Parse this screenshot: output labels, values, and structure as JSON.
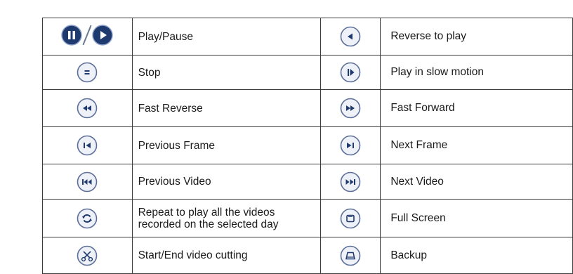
{
  "rows": [
    {
      "left_icon": "play-pause-icon",
      "left_label": "Play/Pause",
      "right_icon": "reverse-play-icon",
      "right_label": "Reverse to play"
    },
    {
      "left_icon": "stop-icon",
      "left_label": "Stop",
      "right_icon": "slow-motion-icon",
      "right_label": "Play in slow motion"
    },
    {
      "left_icon": "fast-reverse-icon",
      "left_label": "Fast Reverse",
      "right_icon": "fast-forward-icon",
      "right_label": "Fast Forward"
    },
    {
      "left_icon": "previous-frame-icon",
      "left_label": "Previous Frame",
      "right_icon": "next-frame-icon",
      "right_label": "Next Frame"
    },
    {
      "left_icon": "previous-video-icon",
      "left_label": "Previous Video",
      "right_icon": "next-video-icon",
      "right_label": "Next Video"
    },
    {
      "left_icon": "repeat-icon",
      "left_label_line1": "Repeat to play all the videos",
      "left_label_line2": "recorded on the selected day",
      "right_icon": "full-screen-icon",
      "right_label": "Full Screen"
    },
    {
      "left_icon": "scissors-icon",
      "left_label": "Start/End video cutting",
      "right_icon": "backup-icon",
      "right_label": "Backup"
    }
  ],
  "colors": {
    "icon_dark": "#1e3a6e",
    "icon_ring": "#5c6f99",
    "icon_fill": "#eef1f8",
    "border": "#3a3a3a"
  }
}
